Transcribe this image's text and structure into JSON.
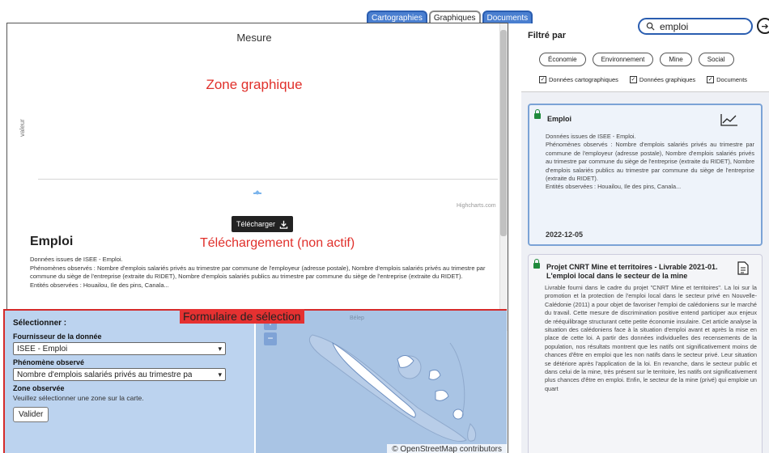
{
  "tabs": [
    {
      "label": "Cartographies",
      "active": false
    },
    {
      "label": "Graphiques",
      "active": true
    },
    {
      "label": "Documents",
      "active": false
    }
  ],
  "chart": {
    "title": "Mesure",
    "zone_label": "Zone graphique",
    "y_axis_label": "valeur",
    "credits": "Highcharts.com",
    "download_label": "Télécharger"
  },
  "dataset": {
    "title": "Emploi",
    "download_zone_label": "Téléchargement (non actif)",
    "description": [
      "Données issues de ISEE - Emploi.",
      "Phénomènes observés : Nombre d'emplois salariés privés au trimestre par commune de l'employeur (adresse postale), Nombre d'emplois salariés privés au trimestre par commune du siège de l'entreprise (extraite du RIDET), Nombre d'emplois salariés publics au trimestre par commune du siège de l'entreprise (extraite du RIDET).",
      "Entités observées : Houailou, Ile des pins, Canala..."
    ]
  },
  "form": {
    "zone_label": "Formulaire de sélection",
    "heading": "Sélectionner :",
    "provider_label": "Fournisseur de la donnée",
    "provider_value": "ISEE - Emploi",
    "phenomenon_label": "Phénomène observé",
    "phenomenon_value": "Nombre d'emplois salariés privés au trimestre pa",
    "zone_obs_label": "Zone observée",
    "zone_hint": "Veuillez sélectionner une zone sur la carte.",
    "submit_label": "Valider"
  },
  "map": {
    "zoom_in": "+",
    "zoom_out": "−",
    "label": "Bélep",
    "attribution": "© OpenStreetMap contributors"
  },
  "filter": {
    "title": "Filtré par",
    "search_value": "emploi",
    "chips": [
      "Économie",
      "Environnement",
      "Mine",
      "Social"
    ],
    "checks": [
      {
        "label": "Données cartographiques",
        "checked": true
      },
      {
        "label": "Données graphiques",
        "checked": true
      },
      {
        "label": "Documents",
        "checked": true
      }
    ]
  },
  "results": [
    {
      "title": "Emploi",
      "body": "Données issues de ISEE - Emploi.\nPhénomènes observés : Nombre d'emplois salariés privés au trimestre par commune de l'employeur (adresse postale), Nombre d'emplois salariés privés au trimestre par commune du siège de l'entreprise (extraite du RIDET), Nombre d'emplois salariés publics au trimestre par commune du siège de l'entreprise (extraite du RIDET).\nEntités observées : Houailou, Ile des pins, Canala...",
      "date": "2022-12-05",
      "icon": "line-chart-icon"
    },
    {
      "title": "Projet CNRT Mine et territoires - Livrable 2021-01. L'emploi local dans le secteur de la mine",
      "body": "Livrable fourni dans le cadre du projet \"CNRT Mine et territoires\". La loi sur la promotion et la protection de l'emploi local dans le secteur privé en Nouvelle-Calédonie (2011) a pour objet de favoriser l'emploi de calédoniens sur le marché du travail. Cette mesure de discrimination positive entend participer aux enjeux de rééquilibrage structurant cette petite économie insulaire. Cet article analyse la situation des calédoniens face à la situation d'emploi avant et après la mise en place de cette loi. A partir des données individuelles des recensements de la population, nos résultats montrent que les natifs ont significativement moins de chances d'être en emploi que les non natifs dans le secteur privé. Leur situation se détériore après l'application de la loi. En revanche, dans le secteur public et dans celui de la mine, très présent sur le territoire, les natifs ont significativement plus chances d'être en emploi. Enfin, le secteur de la mine (privé) qui emploie un quart",
      "icon": "document-icon"
    }
  ]
}
